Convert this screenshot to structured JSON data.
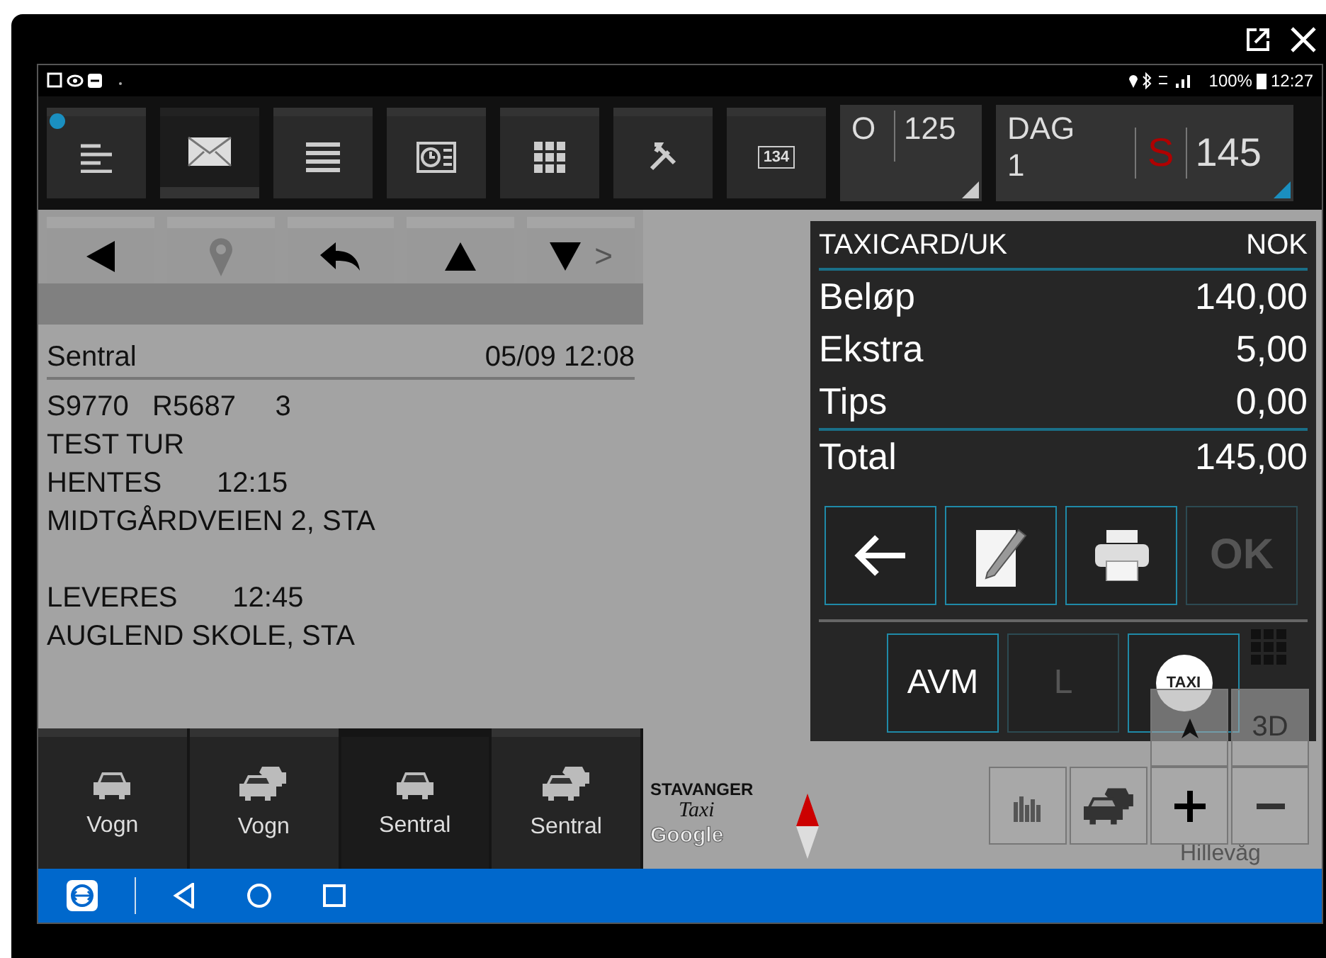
{
  "status_bar": {
    "battery": "100%",
    "time": "12:27"
  },
  "toolbar": {
    "buttons": [
      {
        "kind": "lines",
        "selected": false,
        "dot": true
      },
      {
        "kind": "mail",
        "selected": true,
        "dot": false
      },
      {
        "kind": "list",
        "selected": false,
        "dot": false
      },
      {
        "kind": "clock",
        "selected": false,
        "dot": false
      },
      {
        "kind": "grid",
        "selected": false,
        "dot": false
      },
      {
        "kind": "tools",
        "selected": false,
        "dot": false
      },
      {
        "kind": "meter",
        "selected": false,
        "dot": false,
        "label": "134"
      }
    ],
    "counter": {
      "label": "O",
      "value": "125"
    },
    "shift": {
      "label": "DAG",
      "number": "1",
      "flag": "S",
      "value": "145"
    }
  },
  "nav_buttons": [
    {
      "kind": "left"
    },
    {
      "kind": "pin"
    },
    {
      "kind": "reply"
    },
    {
      "kind": "up"
    },
    {
      "kind": "down",
      "more": ">"
    }
  ],
  "message": {
    "sender": "Sentral",
    "time": "05/09 12:08",
    "lines": [
      "S9770   R5687     3",
      "TEST TUR",
      "HENTES       12:15",
      "MIDTGÅRDVEIEN 2, STA",
      "LEVERES       12:45",
      "AUGLEND SKOLE, STA"
    ]
  },
  "tabs": [
    {
      "label": "Vogn",
      "kind": "single",
      "selected": false
    },
    {
      "label": "Vogn",
      "kind": "multi",
      "selected": false
    },
    {
      "label": "Sentral",
      "kind": "single",
      "selected": true
    },
    {
      "label": "Sentral",
      "kind": "multi",
      "selected": false
    }
  ],
  "payment": {
    "method": "TAXICARD/UK",
    "currency": "NOK",
    "rows": [
      {
        "label": "Beløp",
        "value": "140,00"
      },
      {
        "label": "Ekstra",
        "value": "5,00"
      },
      {
        "label": "Tips",
        "value": "0,00"
      }
    ],
    "total": {
      "label": "Total",
      "value": "145,00"
    },
    "actions": [
      {
        "kind": "back",
        "disabled": false
      },
      {
        "kind": "sign",
        "disabled": false
      },
      {
        "kind": "print",
        "disabled": false
      },
      {
        "kind": "ok",
        "label": "OK",
        "disabled": true
      }
    ],
    "options": [
      {
        "kind": "text",
        "label": "AVM",
        "disabled": false
      },
      {
        "kind": "text",
        "label": "L",
        "disabled": true
      },
      {
        "kind": "taxi",
        "label": "TAXI",
        "disabled": false
      }
    ]
  },
  "map": {
    "view_button": "3D",
    "brand_top": "STAVANGER",
    "brand_script": "Taxi",
    "attribution": "Google",
    "place": "Hillevåg"
  }
}
